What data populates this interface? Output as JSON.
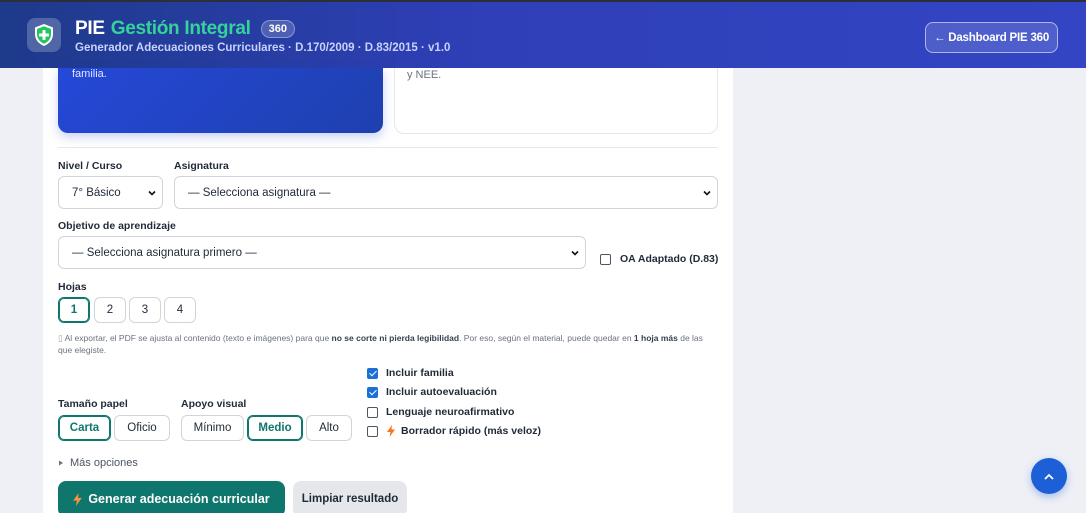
{
  "header": {
    "title_part1": "PIE",
    "title_part2": "Gestión Integral",
    "badge": "360",
    "subtitle": "Generador Adecuaciones Curriculares · D.170/2009 · D.83/2015 · v1.0",
    "dashboard_button": "← Dashboard PIE 360",
    "logo_icon": "shield-plus-icon"
  },
  "panels": {
    "left_text": "familia.",
    "right_text": "y NEE."
  },
  "form": {
    "nivel_label": "Nivel / Curso",
    "nivel_value": "7° Básico",
    "asignatura_label": "Asignatura",
    "asignatura_value": "— Selecciona asignatura —",
    "objetivo_label": "Objetivo de aprendizaje",
    "objetivo_value": "— Selecciona asignatura primero —",
    "oa_adaptado_label": "OA Adaptado (D.83)",
    "oa_adaptado_checked": false,
    "hojas_label": "Hojas",
    "hojas_options": [
      "1",
      "2",
      "3",
      "4"
    ],
    "hojas_selected": "1",
    "note_part1": "Al exportar, el PDF se ajusta al contenido (texto e imágenes) para que ",
    "note_bold1": "no se corte ni pierda legibilidad",
    "note_part2": ". Por eso, según el material, puede quedar en ",
    "note_bold2": "1 hoja más",
    "note_part3": " de las que elegiste.",
    "papel_label": "Tamaño papel",
    "papel_options": [
      "Carta",
      "Oficio"
    ],
    "papel_selected": "Carta",
    "apoyo_label": "Apoyo visual",
    "apoyo_options": [
      "Mínimo",
      "Medio",
      "Alto"
    ],
    "apoyo_selected": "Medio",
    "checks": [
      {
        "label": "Incluir familia",
        "checked": true
      },
      {
        "label": "Incluir autoevaluación",
        "checked": true
      },
      {
        "label": "Lenguaje neuroafirmativo",
        "checked": false
      },
      {
        "label": "Borrador rápido (más veloz)",
        "checked": false
      }
    ],
    "more_options": "Más opciones",
    "generate_button": "Generar adecuación curricular",
    "clear_button": "Limpiar resultado"
  },
  "colors": {
    "header_bg": "#2f3fb8",
    "accent_green": "#34d399",
    "primary_teal": "#0f766e",
    "fab_blue": "#1d5fd6"
  }
}
